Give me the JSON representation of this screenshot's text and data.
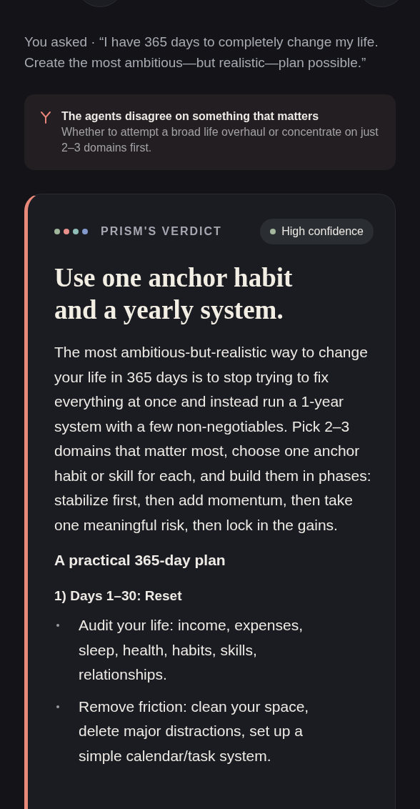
{
  "question": {
    "text": "You asked · “I have 365 days to completely change my life. Create the most ambitious—but realistic—plan possible.”"
  },
  "disagreement": {
    "title": "The agents disagree on something that matters",
    "detail": "Whether to attempt a broad life overhaul or concentrate on just 2–3 domains first."
  },
  "verdict": {
    "agents": [
      {
        "color": "#9fb59c"
      },
      {
        "color": "#e8908a"
      },
      {
        "color": "#8fbdb8"
      },
      {
        "color": "#8399cc"
      }
    ],
    "label": "PRISM'S VERDICT",
    "confidence": {
      "text": "High confidence",
      "color": "#a5b89f"
    },
    "title": "Use one anchor habit and a yearly system.",
    "summary": "The most ambitious-but-realistic way to change your life in 365 days is to stop trying to fix everything at once and instead run a 1-year system with a few non-negotiables. Pick 2–3 domains that matter most, choose one anchor habit or skill for each, and build them in phases: stabilize first, then add momentum, then take one meaningful risk, then lock in the gains.",
    "plan_heading": "A practical 365-day plan",
    "phases": [
      {
        "title": "1) Days 1–30: Reset",
        "bullets": [
          "Audit your life: income, expenses, sleep, health, habits, skills, relationships.",
          "Remove friction: clean your space, delete major distractions, set up a simple calendar/task system."
        ]
      }
    ]
  }
}
